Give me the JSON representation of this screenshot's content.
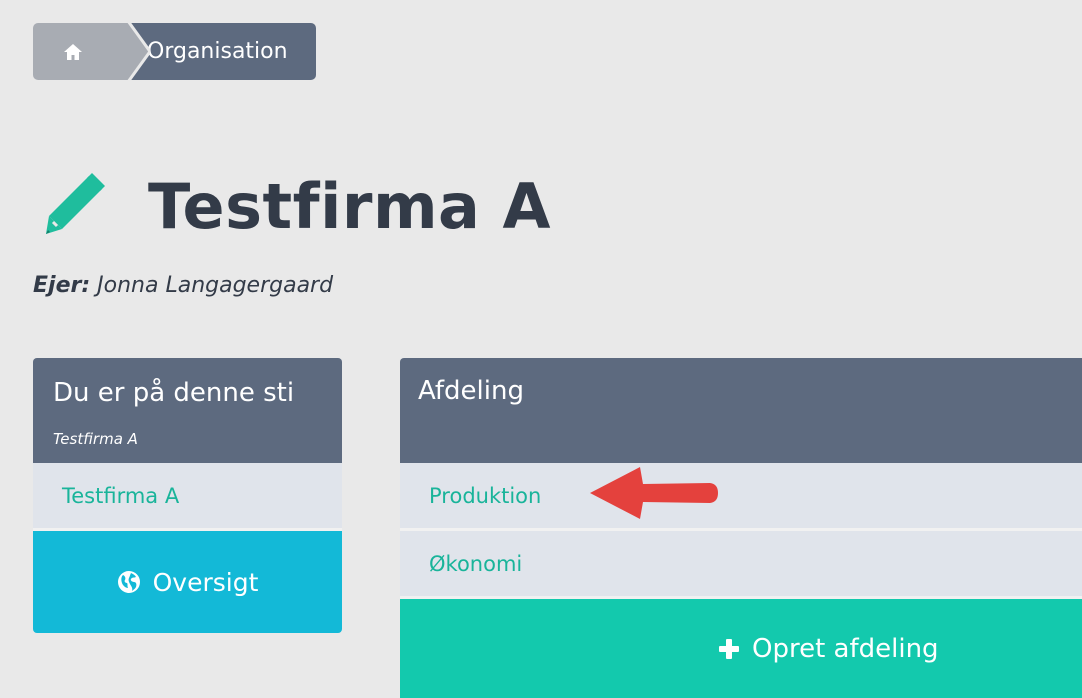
{
  "breadcrumb": {
    "home_icon": "home-icon",
    "current": "Organisation"
  },
  "title": {
    "icon": "pencil-icon",
    "text": "Testfirma A"
  },
  "owner": {
    "label": "Ejer:",
    "name": "Jonna Langagergaard"
  },
  "path_panel": {
    "title": "Du er på denne sti",
    "subtitle": "Testfirma A",
    "items": [
      {
        "label": "Testfirma A"
      }
    ],
    "overview_button": {
      "icon": "globe-icon",
      "label": "Oversigt"
    }
  },
  "dept_panel": {
    "title": "Afdeling",
    "rows": [
      {
        "label": "Produktion"
      },
      {
        "label": "Økonomi"
      }
    ],
    "create_button": {
      "icon": "plus-icon",
      "label": "Opret afdeling"
    }
  },
  "colors": {
    "header": "#5d6a7f",
    "link": "#19b49a",
    "overview": "#13b9d7",
    "create": "#13c9ad",
    "arrow": "#e4413d"
  }
}
